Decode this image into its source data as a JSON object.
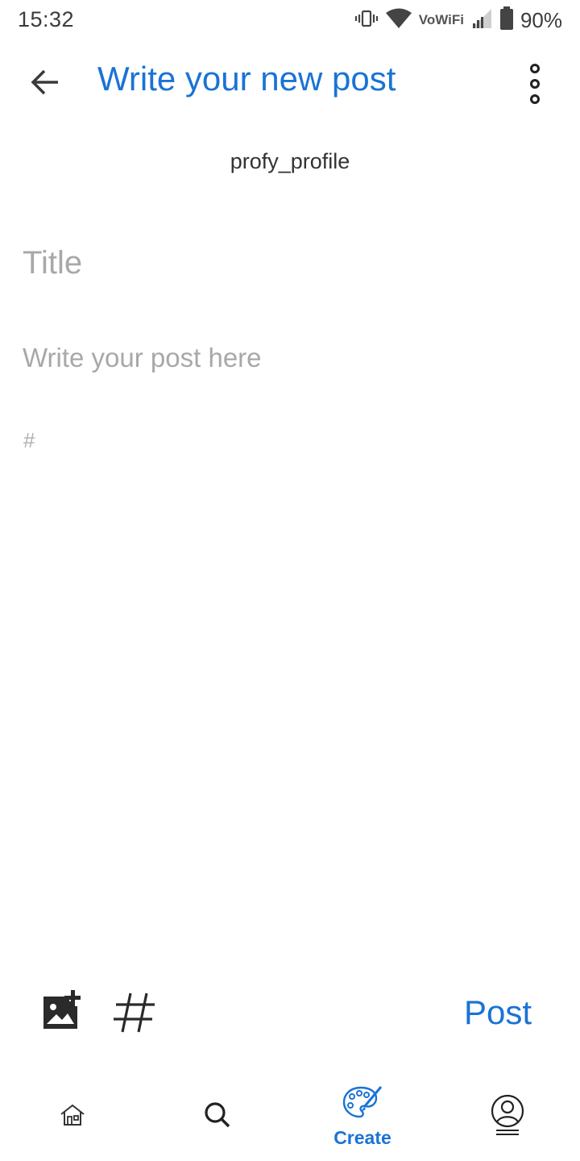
{
  "status_bar": {
    "time": "15:32",
    "network_label": "VoWiFi",
    "battery": "90%",
    "icons": [
      "vibrate-icon",
      "wifi-icon",
      "signal-icon",
      "battery-icon"
    ]
  },
  "app_bar": {
    "title": "Write your new post",
    "back_icon": "arrow-left-icon",
    "menu_icon": "more-vertical-icon"
  },
  "profile": {
    "name": "profy_profile"
  },
  "editor": {
    "title_placeholder": "Title",
    "body_placeholder": "Write your post here",
    "tags_placeholder": "#"
  },
  "toolbar": {
    "add_image_icon": "add-image-icon",
    "hashtag_icon": "hashtag-icon",
    "post_label": "Post"
  },
  "bottom_nav": {
    "items": [
      {
        "id": "home",
        "icon": "home-icon",
        "label": ""
      },
      {
        "id": "search",
        "icon": "search-icon",
        "label": ""
      },
      {
        "id": "create",
        "icon": "palette-icon",
        "label": "Create",
        "active": true
      },
      {
        "id": "profile",
        "icon": "profile-icon",
        "label": ""
      }
    ]
  },
  "colors": {
    "accent": "#1a73d4",
    "placeholder": "#a8a8a8",
    "icon_dark": "#2a2a2a"
  }
}
